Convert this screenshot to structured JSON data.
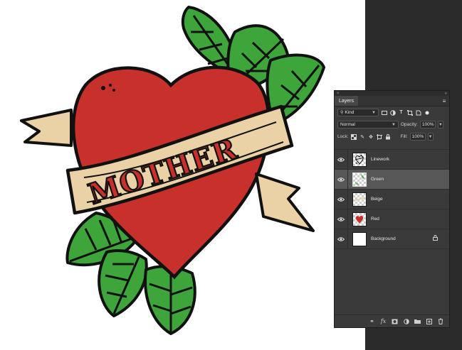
{
  "artwork": {
    "banner_text": "MOTHER"
  },
  "layers_panel": {
    "title": "Layers",
    "collapse_glyph": "»",
    "close_glyph": "×",
    "menu_glyph": "≡",
    "filter": {
      "kind_label": "Kind",
      "icons": [
        "image-filter-icon",
        "adjustment-filter-icon",
        "type-filter-icon",
        "shape-filter-icon",
        "smart-object-filter-icon"
      ]
    },
    "blend_mode": "Normal",
    "opacity_label": "Opacity:",
    "opacity_value": "100%",
    "lock_label": "Lock:",
    "fill_label": "Fill:",
    "fill_value": "100%",
    "layers": [
      {
        "name": "Linework",
        "visible": true,
        "selected": false,
        "thumb": "linework"
      },
      {
        "name": "Green",
        "visible": true,
        "selected": true,
        "thumb": "green"
      },
      {
        "name": "Beige",
        "visible": true,
        "selected": false,
        "thumb": "beige"
      },
      {
        "name": "Red",
        "visible": true,
        "selected": false,
        "thumb": "red"
      },
      {
        "name": "Background",
        "visible": true,
        "selected": false,
        "thumb": "white",
        "locked": true
      }
    ],
    "footer_icons": [
      "link-layers-icon",
      "fx-icon",
      "add-mask-icon",
      "adjustment-layer-icon",
      "new-group-icon",
      "new-layer-icon",
      "delete-layer-icon"
    ]
  },
  "colors": {
    "heart_red": "#c7302b",
    "leaf_green": "#3ea53b",
    "banner_beige": "#ead2a6",
    "outline": "#111111",
    "panel_bg": "#3a3a3a",
    "pasteboard": "#2b2b2b"
  }
}
